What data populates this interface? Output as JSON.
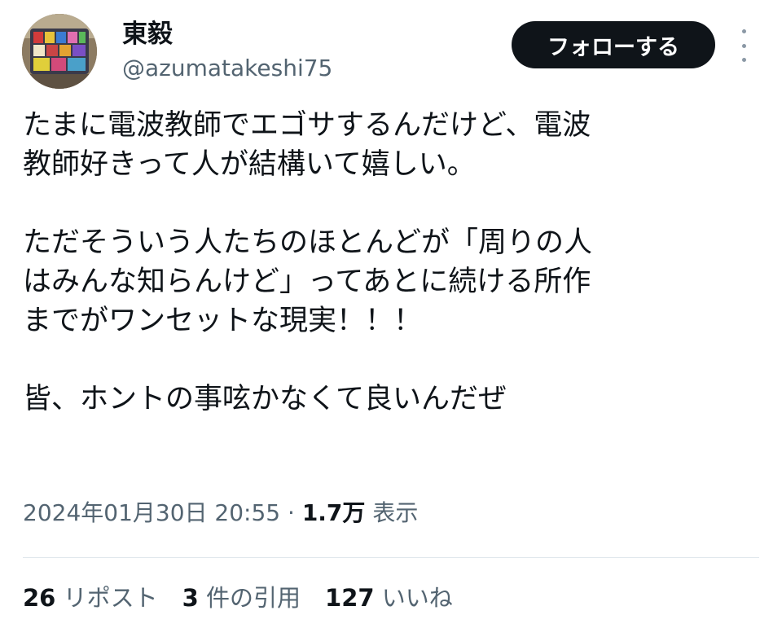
{
  "author": {
    "display_name": "東毅",
    "handle": "@azumatakeshi75",
    "avatar_icon": "profile-photo"
  },
  "follow_button": {
    "label": "フォローする"
  },
  "more_button": {
    "icon": "more-vertical-icon"
  },
  "tweet": {
    "text": "たまに電波教師でエゴサするんだけど、電波\n教師好きって人が結構いて嬉しい。\n\nただそういう人たちのほとんどが「周りの人\nはみんな知らんけど」ってあとに続ける所作\nまでがワンセットな現実！！！\n\n皆、ホントの事呟かなくて良いんだぜ"
  },
  "meta": {
    "timestamp": "2024年01月30日 20:55",
    "separator": " · ",
    "views_count": "1.7万",
    "views_label": " 表示"
  },
  "stats": {
    "reposts_count": "26",
    "reposts_label": "リポスト",
    "quotes_count": "3",
    "quotes_label": "件の引用",
    "likes_count": "127",
    "likes_label": "いいね"
  },
  "colors": {
    "text_primary": "#0f1419",
    "text_secondary": "#536471",
    "button_bg": "#0f1419",
    "divider": "#e1e8ed"
  }
}
